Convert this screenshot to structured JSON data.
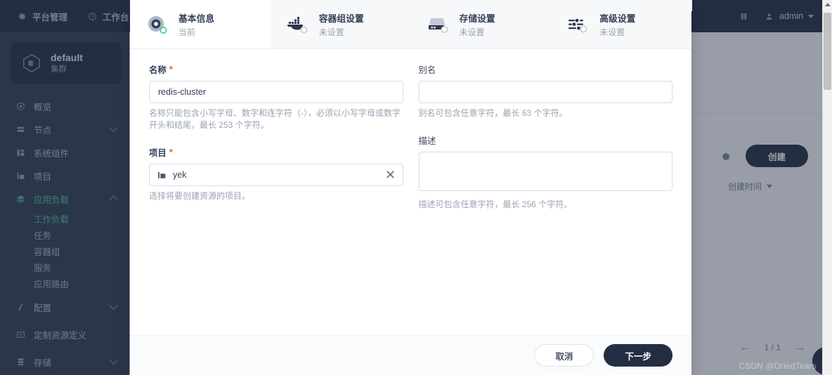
{
  "topbar": {
    "items": [
      {
        "label": "平台管理",
        "icon": "gear-icon"
      },
      {
        "label": "工作台",
        "icon": "dashboard-icon"
      }
    ],
    "book_icon": "book-icon",
    "user": {
      "name": "admin",
      "icon": "user-icon",
      "caret": "chevron-down-icon"
    }
  },
  "sidebar": {
    "cluster": {
      "name": "default",
      "subtitle": "集群",
      "icon": "cube-icon"
    },
    "items": [
      {
        "label": "概览",
        "icon": "overview-icon",
        "expandable": false,
        "active": false
      },
      {
        "label": "节点",
        "icon": "nodes-icon",
        "expandable": true,
        "expanded": false,
        "active": false
      },
      {
        "label": "系统组件",
        "icon": "components-icon",
        "expandable": false,
        "active": false
      },
      {
        "label": "项目",
        "icon": "project-icon",
        "expandable": false,
        "active": false
      },
      {
        "label": "应用负载",
        "icon": "workload-icon",
        "expandable": true,
        "expanded": true,
        "active": true
      },
      {
        "label": "配置",
        "icon": "config-icon",
        "expandable": true,
        "expanded": false,
        "active": false
      },
      {
        "label": "定制资源定义",
        "icon": "crd-icon",
        "expandable": false,
        "active": false
      },
      {
        "label": "存储",
        "icon": "storage-icon",
        "expandable": true,
        "expanded": false,
        "active": false
      }
    ],
    "subitems": [
      {
        "label": "工作负载",
        "active": true
      },
      {
        "label": "任务",
        "active": false
      },
      {
        "label": "容器组",
        "active": false
      },
      {
        "label": "服务",
        "active": false
      },
      {
        "label": "应用路由",
        "active": false
      }
    ]
  },
  "background_page": {
    "gear_icon": "gear-icon",
    "create_button": "创建",
    "sort_label": "创建时间",
    "sort_caret": "chevron-down-icon",
    "pager": {
      "prev": "←",
      "text": "1 / 1",
      "next": "→"
    }
  },
  "modal": {
    "tabs": [
      {
        "title": "基本信息",
        "status": "当前",
        "icon": "disk-record-icon",
        "current": true
      },
      {
        "title": "容器组设置",
        "status": "未设置",
        "icon": "docker-whale-icon",
        "current": false
      },
      {
        "title": "存储设置",
        "status": "未设置",
        "icon": "storage-device-icon",
        "current": false
      },
      {
        "title": "高级设置",
        "status": "未设置",
        "icon": "sliders-icon",
        "current": false
      }
    ],
    "fields": {
      "name": {
        "label": "名称",
        "required": true,
        "value": "redis-cluster",
        "placeholder": "",
        "hint": "名称只能包含小写字母、数字和连字符（-），必须以小写字母或数字开头和结尾，最长 253 个字符。"
      },
      "alias": {
        "label": "别名",
        "required": false,
        "value": "",
        "placeholder": "",
        "hint": "别名可包含任意字符，最长 63 个字符。"
      },
      "project": {
        "label": "项目",
        "required": true,
        "value": "yek",
        "icon": "project-icon",
        "clear_icon": "close-icon",
        "hint": "选择将要创建资源的项目。"
      },
      "description": {
        "label": "描述",
        "required": false,
        "value": "",
        "placeholder": "",
        "hint": "描述可包含任意字符，最长 256 个字符。"
      }
    },
    "footer": {
      "cancel": "取消",
      "next": "下一步"
    }
  },
  "watermark": "CSDN @DriedTears",
  "colors": {
    "dark_navy": "#242e42",
    "sidebar": "#303e52",
    "accent_green": "#55bc8a",
    "required_red": "#e8584f",
    "border": "#d8dce5"
  }
}
